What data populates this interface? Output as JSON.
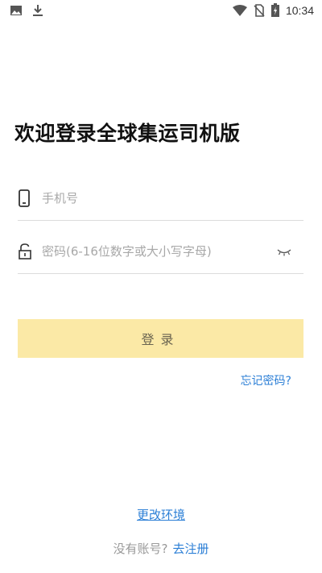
{
  "status_bar": {
    "time": "10:34",
    "icons": [
      "image-icon",
      "download-icon",
      "wifi-icon",
      "no-sim-icon",
      "battery-charging-icon"
    ]
  },
  "title": "欢迎登录全球集运司机版",
  "phone_field": {
    "placeholder": "手机号",
    "value": "",
    "icon": "phone-icon"
  },
  "password_field": {
    "placeholder": "密码(6-16位数字或大小写字母)",
    "value": "",
    "icon": "lock-icon",
    "toggle_icon": "eye-closed-icon"
  },
  "login_button": {
    "label": "登录"
  },
  "forgot_password": "忘记密码?",
  "change_environment": "更改环境",
  "register": {
    "prompt": "没有账号?",
    "link": "去注册"
  },
  "colors": {
    "accent": "#fbe9a6",
    "link": "#2c7fd6"
  }
}
